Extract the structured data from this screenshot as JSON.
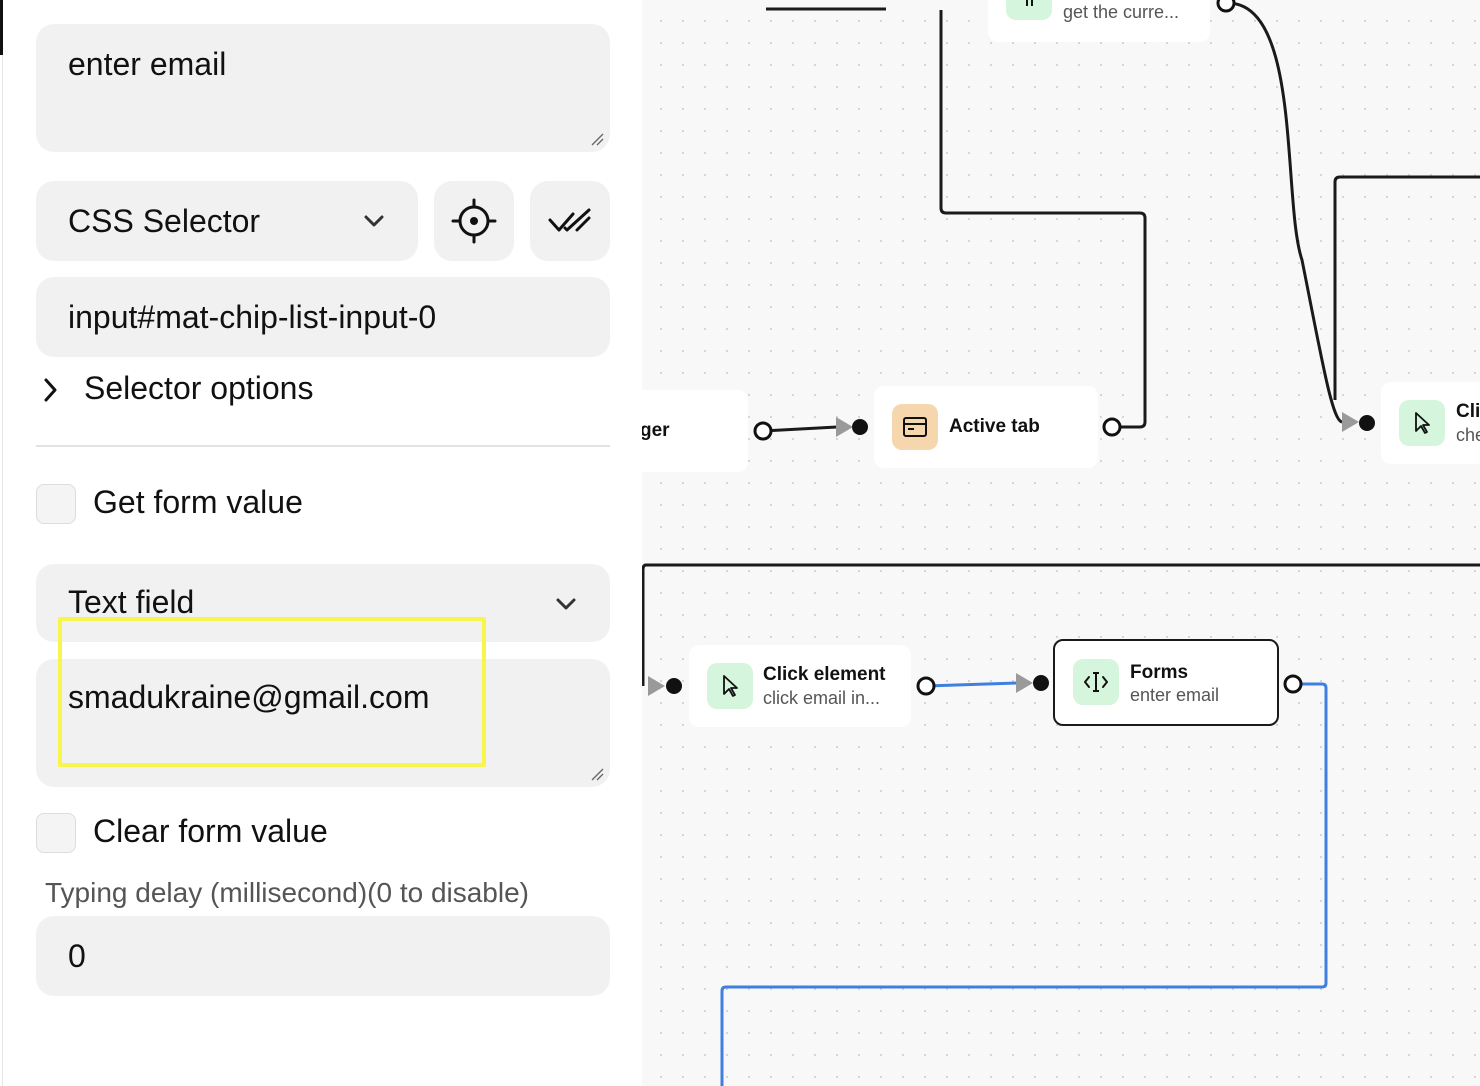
{
  "panel": {
    "description_value": "enter email",
    "selector_type": "CSS Selector",
    "selector_value": "input#mat-chip-list-input-0",
    "selector_options_label": "Selector options",
    "get_form_value_label": "Get form value",
    "form_type": "Text field",
    "form_value": "smadukraine@gmail.com",
    "clear_form_value_label": "Clear form value",
    "typing_delay_label": "Typing delay (millisecond)(0 to disable)",
    "typing_delay_value": "0"
  },
  "canvas": {
    "nodes": {
      "top_partial": {
        "subtitle": "get the curre..."
      },
      "trigger_partial": {
        "title": "ger"
      },
      "active_tab": {
        "title": "Active tab"
      },
      "click_partial": {
        "title": "Cli",
        "subtitle": "che"
      },
      "click_element": {
        "title": "Click element",
        "subtitle": "click email in..."
      },
      "forms": {
        "title": "Forms",
        "subtitle": "enter email"
      }
    },
    "colors": {
      "wire": "#1a1a1a",
      "wire_selected": "#3f7fe0",
      "icon_green": "#d6f5dd",
      "icon_orange": "#f6d6ad"
    }
  }
}
